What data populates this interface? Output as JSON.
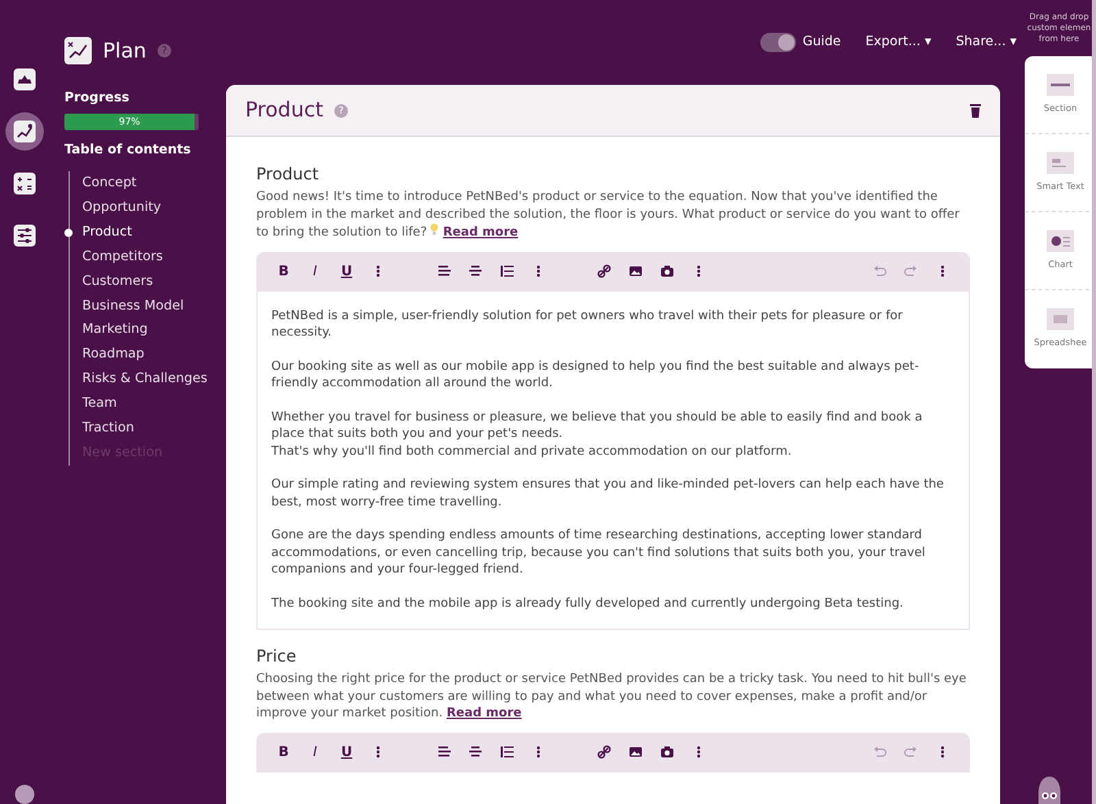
{
  "rail": [
    {
      "selected": false
    },
    {
      "selected": true
    },
    {
      "selected": false
    },
    {
      "selected": false
    }
  ],
  "plan": {
    "title": "Plan",
    "help": "?"
  },
  "progress": {
    "label": "Progress",
    "level": 0.97,
    "reading": "97%"
  },
  "toc": {
    "title": "Table of contents",
    "items": [
      {
        "label": "Concept",
        "selected": false,
        "disabled": false
      },
      {
        "label": "Opportunity",
        "selected": false,
        "disabled": false
      },
      {
        "label": "Product",
        "selected": true,
        "disabled": false
      },
      {
        "label": "Competitors",
        "selected": false,
        "disabled": false
      },
      {
        "label": "Customers",
        "selected": false,
        "disabled": false
      },
      {
        "label": "Business Model",
        "selected": false,
        "disabled": false
      },
      {
        "label": "Marketing",
        "selected": false,
        "disabled": false
      },
      {
        "label": "Roadmap",
        "selected": false,
        "disabled": false
      },
      {
        "label": "Risks & Challenges",
        "selected": false,
        "disabled": false
      },
      {
        "label": "Team",
        "selected": false,
        "disabled": false
      },
      {
        "label": "Traction",
        "selected": false,
        "disabled": false
      },
      {
        "label": "New section",
        "selected": false,
        "disabled": true
      }
    ]
  },
  "header": {
    "guide": {
      "label": "Guide",
      "on": true
    },
    "menus": [
      "Export... ▾",
      "Share... ▾"
    ]
  },
  "card": {
    "title": "Product",
    "help": "?",
    "sections": [
      {
        "heading": "Product",
        "intro": "Good news! It's time to introduce PetNBed's product or service to the equation. Now that you've identified the problem in the market and described the solution, the floor is yours. What product or service do you want to offer to bring the solution to life?",
        "bulb": true,
        "read_more": "Read more",
        "toolbar": [
          {
            "kind": "text",
            "label": "B",
            "disabled": false
          },
          {
            "kind": "text",
            "label": "I",
            "disabled": false
          },
          {
            "kind": "text",
            "label": "U",
            "disabled": false
          },
          {
            "kind": "more",
            "disabled": false
          },
          {
            "kind": "gap"
          },
          {
            "kind": "align-left",
            "disabled": false
          },
          {
            "kind": "align-center",
            "disabled": false
          },
          {
            "kind": "list",
            "disabled": false
          },
          {
            "kind": "more",
            "disabled": false
          },
          {
            "kind": "gap"
          },
          {
            "kind": "link",
            "disabled": false
          },
          {
            "kind": "image",
            "disabled": false
          },
          {
            "kind": "camera",
            "disabled": false
          },
          {
            "kind": "more",
            "disabled": false
          },
          {
            "kind": "spacer"
          },
          {
            "kind": "undo",
            "disabled": true
          },
          {
            "kind": "redo",
            "disabled": true
          },
          {
            "kind": "more",
            "disabled": false
          }
        ],
        "paragraphs": [
          "PetNBed is a simple, user-friendly solution for pet owners who travel with their pets for pleasure or for necessity.",
          "Our booking site as well as our mobile app is designed to help you find the best suitable and always pet-friendly accommodation all around the world.",
          "Whether you travel for business or pleasure, we believe that you should be able to easily find and book a place that suits both you and your pet's needs.\nThat's why you'll find both commercial and private accommodation on our platform.",
          "Our simple rating and reviewing system ensures that you and like-minded pet-lovers can help each have the best, most worry-free time travelling.",
          "Gone are the days spending endless amounts of time researching destinations, accepting lower standard accommodations, or even cancelling trip, because you can't find solutions that suits both you, your travel companions and your four-legged friend.",
          "The booking site and the mobile app is already fully developed and currently undergoing Beta testing."
        ]
      },
      {
        "heading": "Price",
        "intro": "Choosing the right price for the product or service PetNBed provides can be a tricky task. You need to hit bull's eye between what your customers are willing to pay and what you need to cover expenses, make a profit and/or improve your market position.",
        "bulb": false,
        "read_more": "Read more",
        "toolbar": [
          {
            "kind": "text",
            "label": "B",
            "disabled": false
          },
          {
            "kind": "text",
            "label": "I",
            "disabled": false
          },
          {
            "kind": "text",
            "label": "U",
            "disabled": false
          },
          {
            "kind": "more",
            "disabled": false
          },
          {
            "kind": "gap"
          },
          {
            "kind": "align-left",
            "disabled": false
          },
          {
            "kind": "align-center",
            "disabled": false
          },
          {
            "kind": "list",
            "disabled": false
          },
          {
            "kind": "more",
            "disabled": false
          },
          {
            "kind": "gap"
          },
          {
            "kind": "link",
            "disabled": false
          },
          {
            "kind": "image",
            "disabled": false
          },
          {
            "kind": "camera",
            "disabled": false
          },
          {
            "kind": "more",
            "disabled": false
          },
          {
            "kind": "spacer"
          },
          {
            "kind": "undo",
            "disabled": true
          },
          {
            "kind": "redo",
            "disabled": true
          },
          {
            "kind": "more",
            "disabled": false
          }
        ]
      }
    ]
  },
  "elements": {
    "hint": "Drag and drop\ncustom elemen\nfrom here",
    "items": [
      {
        "label": "Section"
      },
      {
        "label": "Smart Text"
      },
      {
        "label": "Chart"
      },
      {
        "label": "Spreadshee"
      }
    ]
  }
}
